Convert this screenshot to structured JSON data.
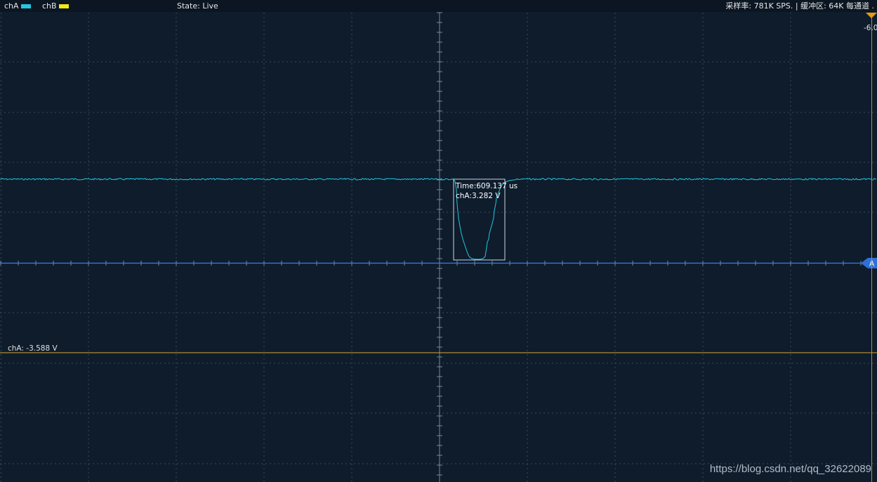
{
  "topbar": {
    "channels": [
      {
        "label": "chA",
        "color": "#22c8e0"
      },
      {
        "label": "chB",
        "color": "#f2e51a"
      }
    ],
    "state": "State: Live",
    "sample_info": "采样率: 781K SPS. | 缓冲区: 64K 每通道 ."
  },
  "colors": {
    "background": "#0e1c2c",
    "grid": "#3a4a5a",
    "axis": "#7d8896",
    "waveform": "#22c8e0",
    "trigger_line": "#3b7ee6",
    "cursor_line": "#d9a62a",
    "tooltip_border": "#cfd6de"
  },
  "trigger": {
    "marker_label": "A",
    "top_marker_label": "-6.0"
  },
  "cursor": {
    "label": "chA: -3.588 V"
  },
  "tooltip": {
    "time": "Time:609.137 us",
    "value": "chA:3.282 V"
  },
  "watermark": "https://blog.csdn.net/qq_32622089"
}
